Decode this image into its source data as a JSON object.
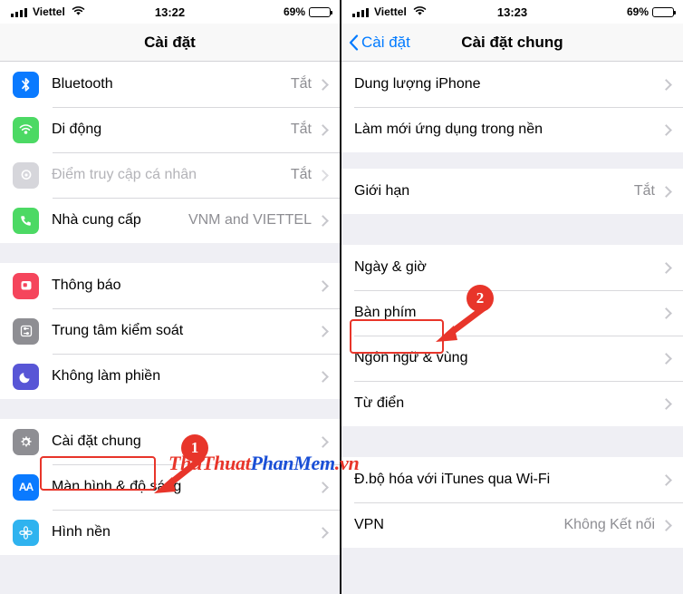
{
  "left_screen": {
    "status_bar": {
      "carrier": "Viettel",
      "time": "13:22",
      "battery_pct": "69%",
      "wifi_icon": "wifi-icon",
      "signal_icon": "signal-bars-icon",
      "battery_icon": "battery-icon"
    },
    "nav": {
      "title": "Cài đặt"
    },
    "groups": [
      {
        "rows": [
          {
            "label": "Bluetooth",
            "value": "Tắt",
            "icon": "bluetooth-icon",
            "icon_color": "#0a7aff",
            "dim": false
          },
          {
            "label": "Di động",
            "value": "Tắt",
            "icon": "cellular-icon",
            "icon_color": "#4cd964",
            "dim": false
          },
          {
            "label": "Điểm truy cập cá nhân",
            "value": "Tắt",
            "icon": "personal-hotspot-icon",
            "icon_color": "#d6d6db",
            "dim": true
          },
          {
            "label": "Nhà cung cấp",
            "value": "VNM and VIETTEL",
            "icon": "carrier-phone-icon",
            "icon_color": "#4cd964",
            "dim": false
          }
        ]
      },
      {
        "rows": [
          {
            "label": "Thông báo",
            "value": "",
            "icon": "notifications-icon",
            "icon_color": "#f5455c",
            "dim": false
          },
          {
            "label": "Trung tâm kiểm soát",
            "value": "",
            "icon": "control-center-icon",
            "icon_color": "#8e8e93",
            "dim": false
          },
          {
            "label": "Không làm phiền",
            "value": "",
            "icon": "do-not-disturb-moon-icon",
            "icon_color": "#5856d6",
            "dim": false
          }
        ]
      },
      {
        "rows": [
          {
            "label": "Cài đặt chung",
            "value": "",
            "icon": "gear-icon",
            "icon_color": "#8e8e93",
            "dim": false
          },
          {
            "label": "Màn hình & độ sáng",
            "value": "",
            "icon": "display-brightness-icon",
            "icon_color": "#0a7aff",
            "dim": false
          },
          {
            "label": "Hình nền",
            "value": "",
            "icon": "wallpaper-flower-icon",
            "icon_color": "#2fb3ef",
            "dim": false
          }
        ]
      }
    ],
    "annotation": {
      "badge": "1",
      "highlight_row": "Cài đặt chung"
    }
  },
  "right_screen": {
    "status_bar": {
      "carrier": "Viettel",
      "time": "13:23",
      "battery_pct": "69%",
      "wifi_icon": "wifi-icon",
      "signal_icon": "signal-bars-icon",
      "battery_icon": "battery-icon"
    },
    "nav": {
      "back_label": "Cài đặt",
      "title": "Cài đặt chung"
    },
    "groups": [
      {
        "rows": [
          {
            "label": "Dung lượng iPhone",
            "value": ""
          },
          {
            "label": "Làm mới ứng dụng trong nền",
            "value": ""
          }
        ]
      },
      {
        "rows": [
          {
            "label": "Giới hạn",
            "value": "Tắt"
          }
        ]
      },
      {
        "rows": [
          {
            "label": "Ngày & giờ",
            "value": ""
          },
          {
            "label": "Bàn phím",
            "value": ""
          },
          {
            "label": "Ngôn ngữ & vùng",
            "value": ""
          },
          {
            "label": "Từ điển",
            "value": ""
          }
        ]
      },
      {
        "rows": [
          {
            "label": "Đ.bộ hóa với iTunes qua Wi-Fi",
            "value": ""
          },
          {
            "label": "VPN",
            "value": "Không Kết nối"
          }
        ]
      }
    ],
    "annotation": {
      "badge": "2",
      "highlight_row": "Bàn phím"
    }
  },
  "watermark": {
    "part1": "ThuThuat",
    "part2": "PhanMem",
    "part3": ".vn"
  },
  "colors": {
    "accent_red": "#e8352a",
    "ios_blue": "#007aff",
    "list_bg": "#efeff4"
  }
}
